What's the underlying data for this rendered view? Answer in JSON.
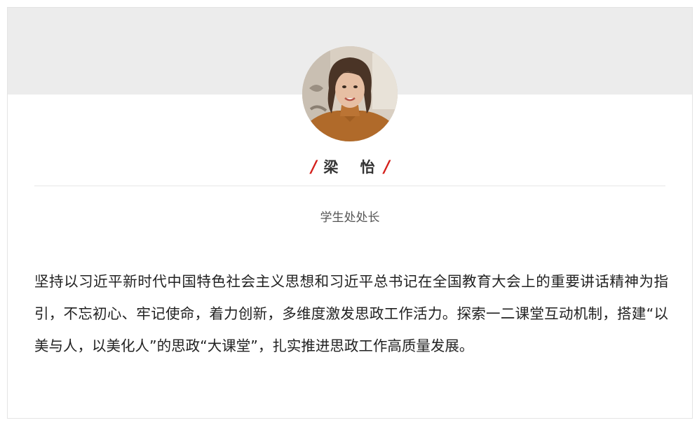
{
  "profile": {
    "name": "梁 怡",
    "slash_left": "/",
    "slash_right": "/",
    "title": "学生处处长",
    "statement": "坚持以习近平新时代中国特色社会主义思想和习近平总书记在全国教育大会上的重要讲话精神为指引，不忘初心、牢记使命，着力创新，多维度激发思政工作活力。探索一二课堂互动机制，搭建“以美与人，以美化人”的思政“大课堂”，扎实推进思政工作高质量发展。"
  },
  "colors": {
    "accent": "#d4201b",
    "banner": "#ececec",
    "text": "#222222",
    "muted": "#555555"
  }
}
